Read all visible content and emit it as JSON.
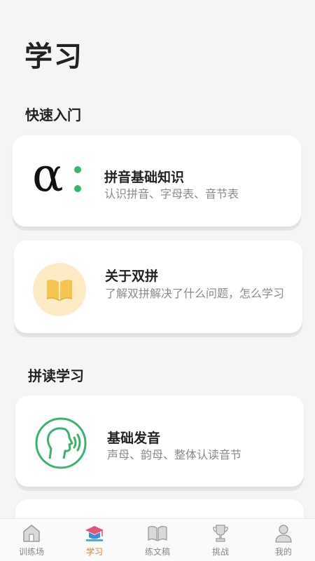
{
  "page": {
    "title": "学习"
  },
  "sections": [
    {
      "title": "快速入门"
    },
    {
      "title": "拼读学习"
    }
  ],
  "cards": [
    {
      "title": "拼音基础知识",
      "desc": "认识拼音、字母表、音节表"
    },
    {
      "title": "关于双拼",
      "desc": "了解双拼解决了什么问题，怎么学习"
    },
    {
      "title": "基础发音",
      "desc": "声母、韵母、整体认读音节"
    }
  ],
  "alpha_glyph": "α",
  "tabs": [
    {
      "label": "训练场",
      "icon": "house-icon"
    },
    {
      "label": "学习",
      "icon": "graduation-cap-icon"
    },
    {
      "label": "练文稿",
      "icon": "book-icon"
    },
    {
      "label": "挑战",
      "icon": "trophy-icon"
    },
    {
      "label": "我的",
      "icon": "user-icon"
    }
  ],
  "colors": {
    "accent": "#e47b34",
    "green": "#3ab36b",
    "book_yellow": "#f5c451",
    "book_bg": "#fdebc6"
  }
}
